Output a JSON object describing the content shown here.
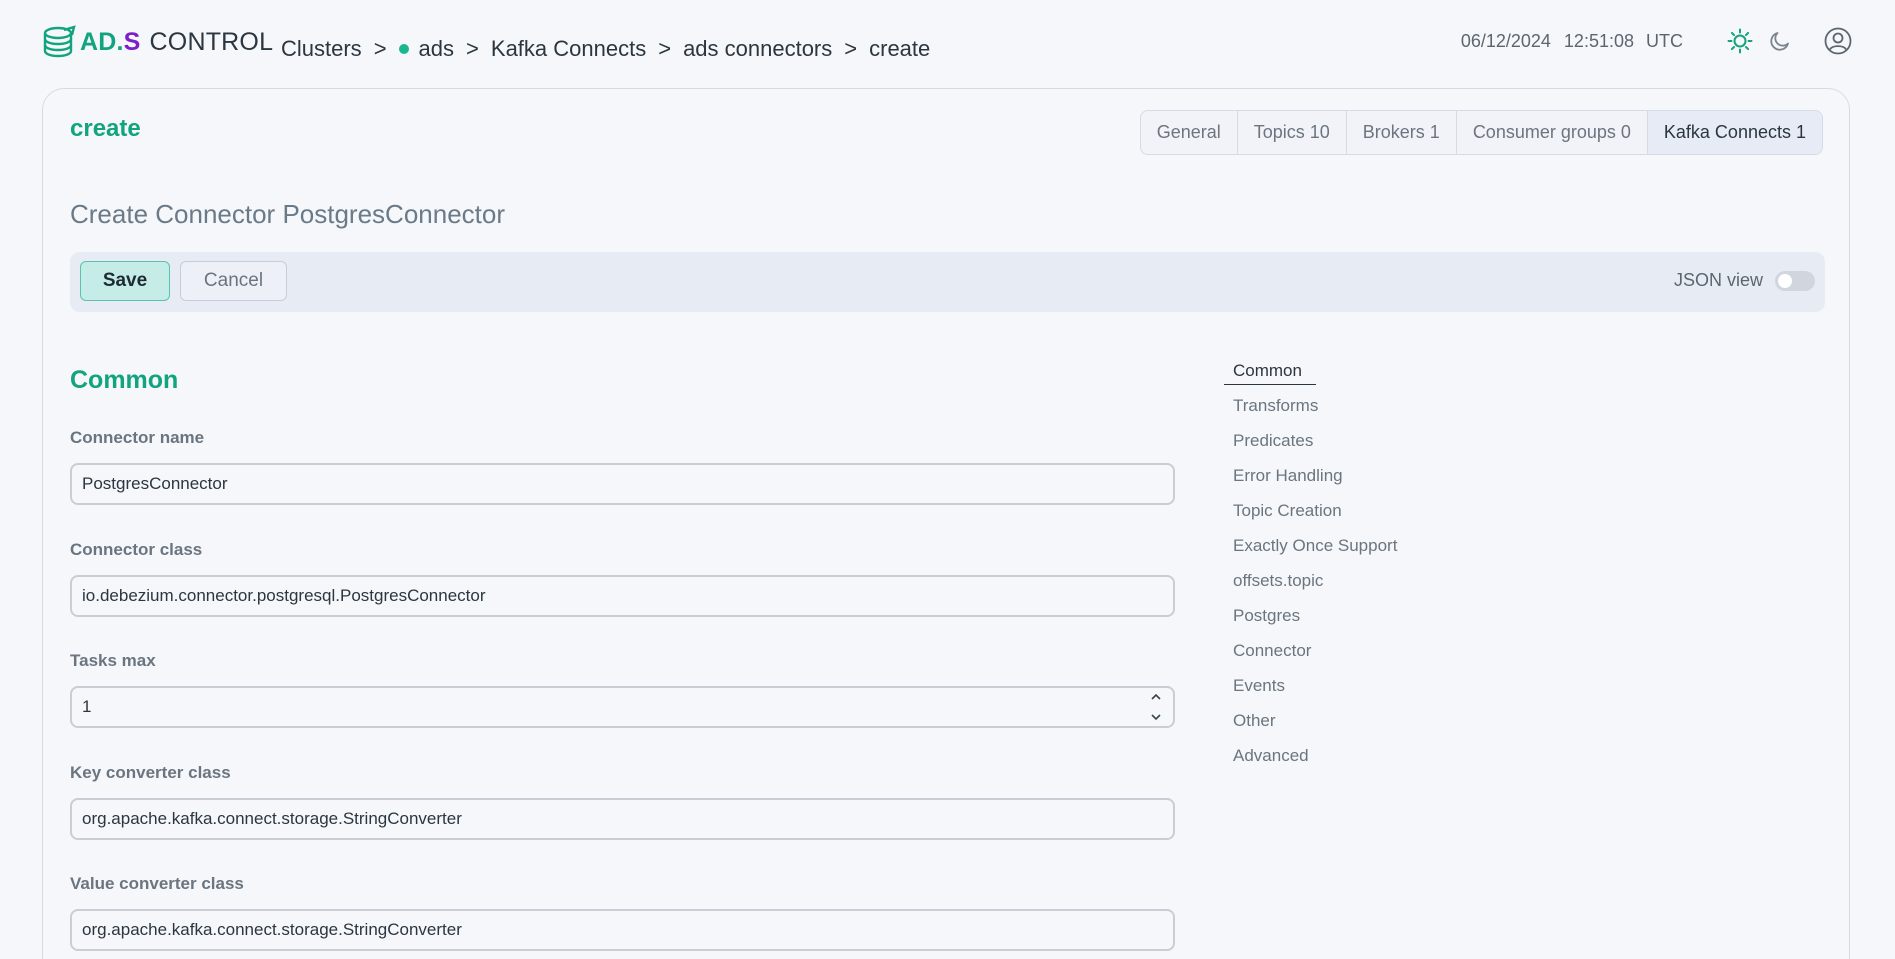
{
  "brand": {
    "ad": "AD",
    "dot": ".",
    "s": "S",
    "control": "CONTROL",
    "accent": "#12a37f",
    "purple": "#7d1fc9"
  },
  "breadcrumb": {
    "items": [
      "Clusters",
      "ads",
      "Kafka Connects",
      "ads connectors",
      "create"
    ],
    "separator": ">",
    "status_color": "#17b890"
  },
  "header": {
    "date": "06/12/2024",
    "time": "12:51:08",
    "timezone": "UTC",
    "icons": [
      "sun-icon",
      "moon-icon",
      "user-icon"
    ]
  },
  "card": {
    "title": "create",
    "tabs": [
      {
        "label": "General",
        "active": false
      },
      {
        "label": "Topics 10",
        "active": false
      },
      {
        "label": "Brokers 1",
        "active": false
      },
      {
        "label": "Consumer groups 0",
        "active": false
      },
      {
        "label": "Kafka Connects 1",
        "active": true
      }
    ]
  },
  "page": {
    "heading": "Create Connector PostgresConnector"
  },
  "toolbar": {
    "save_label": "Save",
    "cancel_label": "Cancel",
    "json_view_label": "JSON view",
    "json_view_on": false
  },
  "form": {
    "section_title": "Common",
    "fields": [
      {
        "label": "Connector name",
        "value": "PostgresConnector"
      },
      {
        "label": "Connector class",
        "value": "io.debezium.connector.postgresql.PostgresConnector"
      },
      {
        "label": "Tasks max",
        "value": "1"
      },
      {
        "label": "Key converter class",
        "value": "org.apache.kafka.connect.storage.StringConverter"
      },
      {
        "label": "Value converter class",
        "value": "org.apache.kafka.connect.storage.StringConverter"
      }
    ]
  },
  "side_nav": {
    "items": [
      "Common",
      "Transforms",
      "Predicates",
      "Error Handling",
      "Topic Creation",
      "Exactly Once Support",
      "offsets.topic",
      "Postgres",
      "Connector",
      "Events",
      "Other",
      "Advanced"
    ],
    "active_index": 0
  }
}
